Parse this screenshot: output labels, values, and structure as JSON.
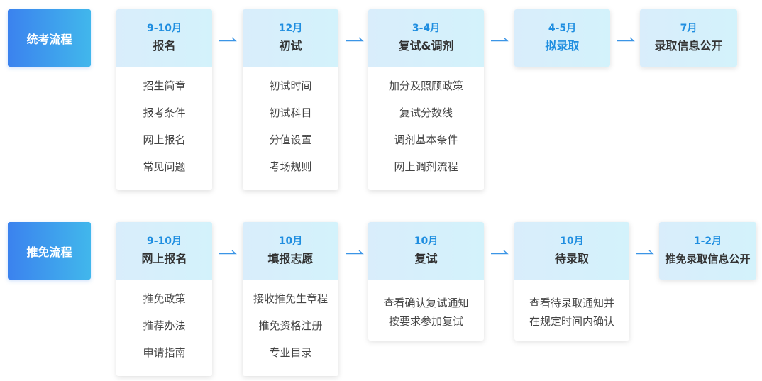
{
  "rows": [
    {
      "label": "统考流程",
      "stages": [
        {
          "month": "9-10月",
          "title": "报名",
          "items": [
            "招生简章",
            "报考条件",
            "网上报名",
            "常见问题"
          ]
        },
        {
          "month": "12月",
          "title": "初试",
          "items": [
            "初试时间",
            "初试科目",
            "分值设置",
            "考场规则"
          ]
        },
        {
          "month": "3-4月",
          "title": "复试&调剂",
          "items": [
            "加分及照顾政策",
            "复试分数线",
            "调剂基本条件",
            "网上调剂流程"
          ]
        },
        {
          "month": "4-5月",
          "title": "拟录取"
        },
        {
          "month": "7月",
          "title": "录取信息公开"
        }
      ]
    },
    {
      "label": "推免流程",
      "stages": [
        {
          "month": "9-10月",
          "title": "网上报名",
          "items": [
            "推免政策",
            "推荐办法",
            "申请指南"
          ]
        },
        {
          "month": "10月",
          "title": "填报志愿",
          "items": [
            "接收推免生章程",
            "推免资格注册",
            "专业目录"
          ]
        },
        {
          "month": "10月",
          "title": "复试",
          "note": [
            "查看确认复试通知",
            "按要求参加复试"
          ]
        },
        {
          "month": "10月",
          "title": "待录取",
          "note": [
            "查看待录取通知并",
            "在规定时间内确认"
          ]
        },
        {
          "month": "1-2月",
          "title": "推免录取信息公开"
        }
      ]
    }
  ],
  "colors": {
    "accent": "#1f8ee0",
    "label_start": "#3b82ee",
    "label_end": "#41b7ec",
    "arrow": "#3b95e6"
  },
  "icons": {
    "connector": "arrow-right-icon"
  }
}
